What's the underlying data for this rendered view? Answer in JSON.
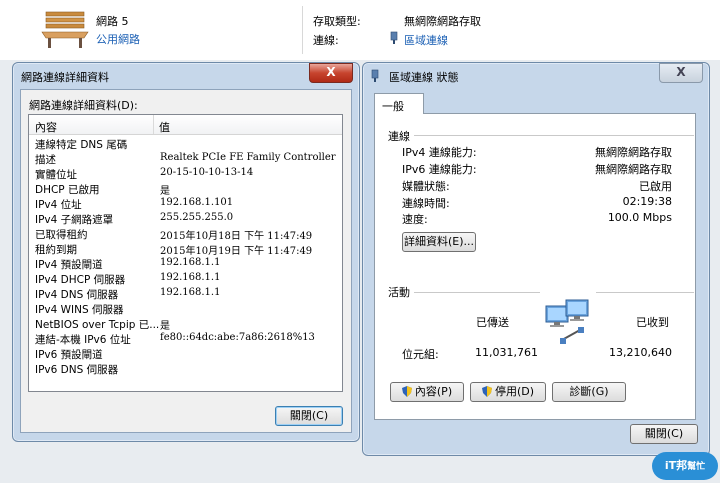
{
  "network_center": {
    "network_name": "網路 5",
    "network_type": "公用網路",
    "access_type_label": "存取類型:",
    "access_type_value": "無網際網路存取",
    "connection_label": "連線:",
    "connection_value": "區域連線"
  },
  "details_window": {
    "title": "網路連線詳細資料",
    "close_glyph": "X",
    "list_label": "網路連線詳細資料(D):",
    "columns": [
      "內容",
      "值"
    ],
    "rows": [
      {
        "prop": "連線特定 DNS 尾碼",
        "value": ""
      },
      {
        "prop": "描述",
        "value": "Realtek PCIe FE Family Controller"
      },
      {
        "prop": "實體位址",
        "value": "20-15-10-10-13-14"
      },
      {
        "prop": "DHCP 已啟用",
        "value": "是"
      },
      {
        "prop": "IPv4 位址",
        "value": "192.168.1.101"
      },
      {
        "prop": "IPv4 子網路遮罩",
        "value": "255.255.255.0"
      },
      {
        "prop": "已取得租約",
        "value": "2015年10月18日 下午 11:47:49"
      },
      {
        "prop": "租約到期",
        "value": "2015年10月19日 下午 11:47:49"
      },
      {
        "prop": "IPv4 預設閘道",
        "value": "192.168.1.1"
      },
      {
        "prop": "IPv4 DHCP 伺服器",
        "value": "192.168.1.1"
      },
      {
        "prop": "IPv4 DNS 伺服器",
        "value": "192.168.1.1"
      },
      {
        "prop": "IPv4 WINS 伺服器",
        "value": ""
      },
      {
        "prop": "NetBIOS over Tcpip 已...",
        "value": "是"
      },
      {
        "prop": "連結-本機 IPv6 位址",
        "value": "fe80::64dc:abe:7a86:2618%13"
      },
      {
        "prop": "IPv6 預設閘道",
        "value": ""
      },
      {
        "prop": "IPv6 DNS 伺服器",
        "value": ""
      }
    ],
    "close_button": "關閉(C)"
  },
  "status_window": {
    "title": "區域連線 狀態",
    "close_glyph": "X",
    "tab": "一般",
    "connection_group": "連線",
    "fields": [
      {
        "label": "IPv4 連線能力:",
        "value": "無網際網路存取"
      },
      {
        "label": "IPv6 連線能力:",
        "value": "無網際網路存取"
      },
      {
        "label": "媒體狀態:",
        "value": "已啟用"
      },
      {
        "label": "連線時間:",
        "value": "02:19:38"
      },
      {
        "label": "速度:",
        "value": "100.0 Mbps"
      }
    ],
    "details_button": "詳細資料(E)...",
    "activity_group": "活動",
    "sent_label": "已傳送",
    "received_label": "已收到",
    "bytes_label": "位元組:",
    "bytes_sent": "11,031,761",
    "bytes_received": "13,210,640",
    "properties_button": "內容(P)",
    "disable_button": "停用(D)",
    "diagnose_button": "診斷(G)",
    "close_button": "關閉(C)"
  },
  "watermark": {
    "text1": "iT邦",
    "text2": "幫忙"
  },
  "colors": {
    "link": "#1a5fb4",
    "close_red": "#c7442e",
    "window_frame": "#c6d7ea"
  }
}
